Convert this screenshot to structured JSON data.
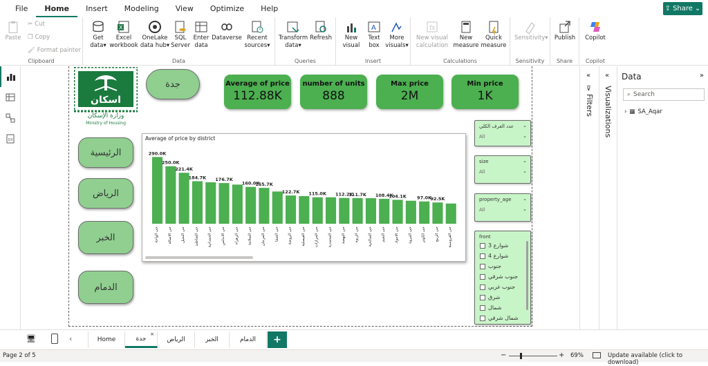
{
  "menu": {
    "items": [
      "File",
      "Home",
      "Insert",
      "Modeling",
      "View",
      "Optimize",
      "Help"
    ],
    "active": "Home",
    "share": "Share"
  },
  "ribbon": {
    "clipboard": {
      "paste": "Paste",
      "cut": "Cut",
      "copy": "Copy",
      "format_painter": "Format painter",
      "label": "Clipboard"
    },
    "data": {
      "get_data": "Get data",
      "excel": "Excel workbook",
      "onelake": "OneLake data hub",
      "sql": "SQL Server",
      "enter": "Enter data",
      "dataverse": "Dataverse",
      "recent": "Recent sources",
      "label": "Data"
    },
    "queries": {
      "transform": "Transform data",
      "refresh": "Refresh",
      "label": "Queries"
    },
    "insert": {
      "new_visual": "New visual",
      "text_box": "Text box",
      "more_visuals": "More visuals",
      "label": "Insert"
    },
    "calculations": {
      "new_visual_calc": "New visual calculation",
      "new_measure": "New measure",
      "quick_measure": "Quick measure",
      "label": "Calculations"
    },
    "sensitivity": {
      "btn": "Sensitivity",
      "label": "Sensitivity"
    },
    "share": {
      "publish": "Publish",
      "label": "Share"
    },
    "copilot": {
      "btn": "Copilot",
      "label": "Copilot"
    }
  },
  "report": {
    "logo": {
      "arabic": "إسكان",
      "ministry_ar": "وزارة الإسكان",
      "ministry_en": "Ministry of Housing"
    },
    "current_city": "جدة",
    "nav_buttons": [
      "الرئيسية",
      "الرياض",
      "الخبر",
      "الدمام"
    ],
    "kpis": [
      {
        "label": "Average of price",
        "value": "112.88K"
      },
      {
        "label": "number of units",
        "value": "888"
      },
      {
        "label": "Max price",
        "value": "2M"
      },
      {
        "label": "Min price",
        "value": "1K"
      }
    ],
    "slicers": {
      "rooms": {
        "title": "عدد الغرف الكلي",
        "value": "All"
      },
      "size": {
        "title": "size",
        "value": "All"
      },
      "property_age": {
        "title": "property_age",
        "value": "All"
      },
      "front": {
        "title": "front",
        "options": [
          "شوارع 3",
          "شوارع 4",
          "جنوب",
          "جنوب شرقي",
          "جنوب غربي",
          "شرق",
          "شمال",
          "شمال شرقي"
        ]
      }
    }
  },
  "chart_data": {
    "type": "bar",
    "title": "Average of price by district",
    "categories": [
      "حي الواحة",
      "حي الاصالة",
      "حي النخيل",
      "حي الشاطئ",
      "حي الحمدانية",
      "حي الاندلس",
      "حي الزهراء",
      "حي السلامة",
      "حي المرجان",
      "حي الصفا",
      "حي الروضة",
      "حي الفيصلية",
      "حي الحرازات",
      "حي المحمدية",
      "حي النهضة",
      "حي الربوة",
      "حي الصالحية",
      "حي النعيم",
      "حي الاجواد",
      "حي المروة",
      "حي الكوثر",
      "حي الربيع",
      "حي الفروسية"
    ],
    "values": [
      290000,
      250000,
      221400,
      184700,
      180000,
      176700,
      170000,
      160000,
      155700,
      140000,
      122700,
      120000,
      115000,
      115000,
      112200,
      111700,
      111000,
      108400,
      104100,
      100000,
      97000,
      92500,
      88000
    ],
    "data_labels": [
      "290.0K",
      "250.0K",
      "221.4K",
      "184.7K",
      "",
      "176.7K",
      "",
      "160.0K",
      "155.7K",
      "",
      "122.7K",
      "",
      "115.0K",
      "",
      "112.2K",
      "111.7K",
      "",
      "108.4K",
      "104.1K",
      "",
      "97.0K",
      "92.5K",
      ""
    ],
    "ylim": [
      0,
      300000
    ],
    "bar_color": "#4caf50"
  },
  "pages": {
    "tabs": [
      "Home",
      "جدة",
      "الرياض",
      "الخبر",
      "الدمام"
    ],
    "active": "جدة",
    "add": "+"
  },
  "panes": {
    "filters": "Filters",
    "visualizations": "Visualizations",
    "data_title": "Data",
    "search_placeholder": "Search",
    "table": "SA_Aqar"
  },
  "status": {
    "page": "Page 2 of 5",
    "zoom": "69%",
    "update": "Update available (click to download)"
  },
  "colors": {
    "accent": "#117865",
    "kpi": "#4caf50",
    "nav_button": "#90cf90",
    "slicer_bg": "#c8f5c8"
  }
}
